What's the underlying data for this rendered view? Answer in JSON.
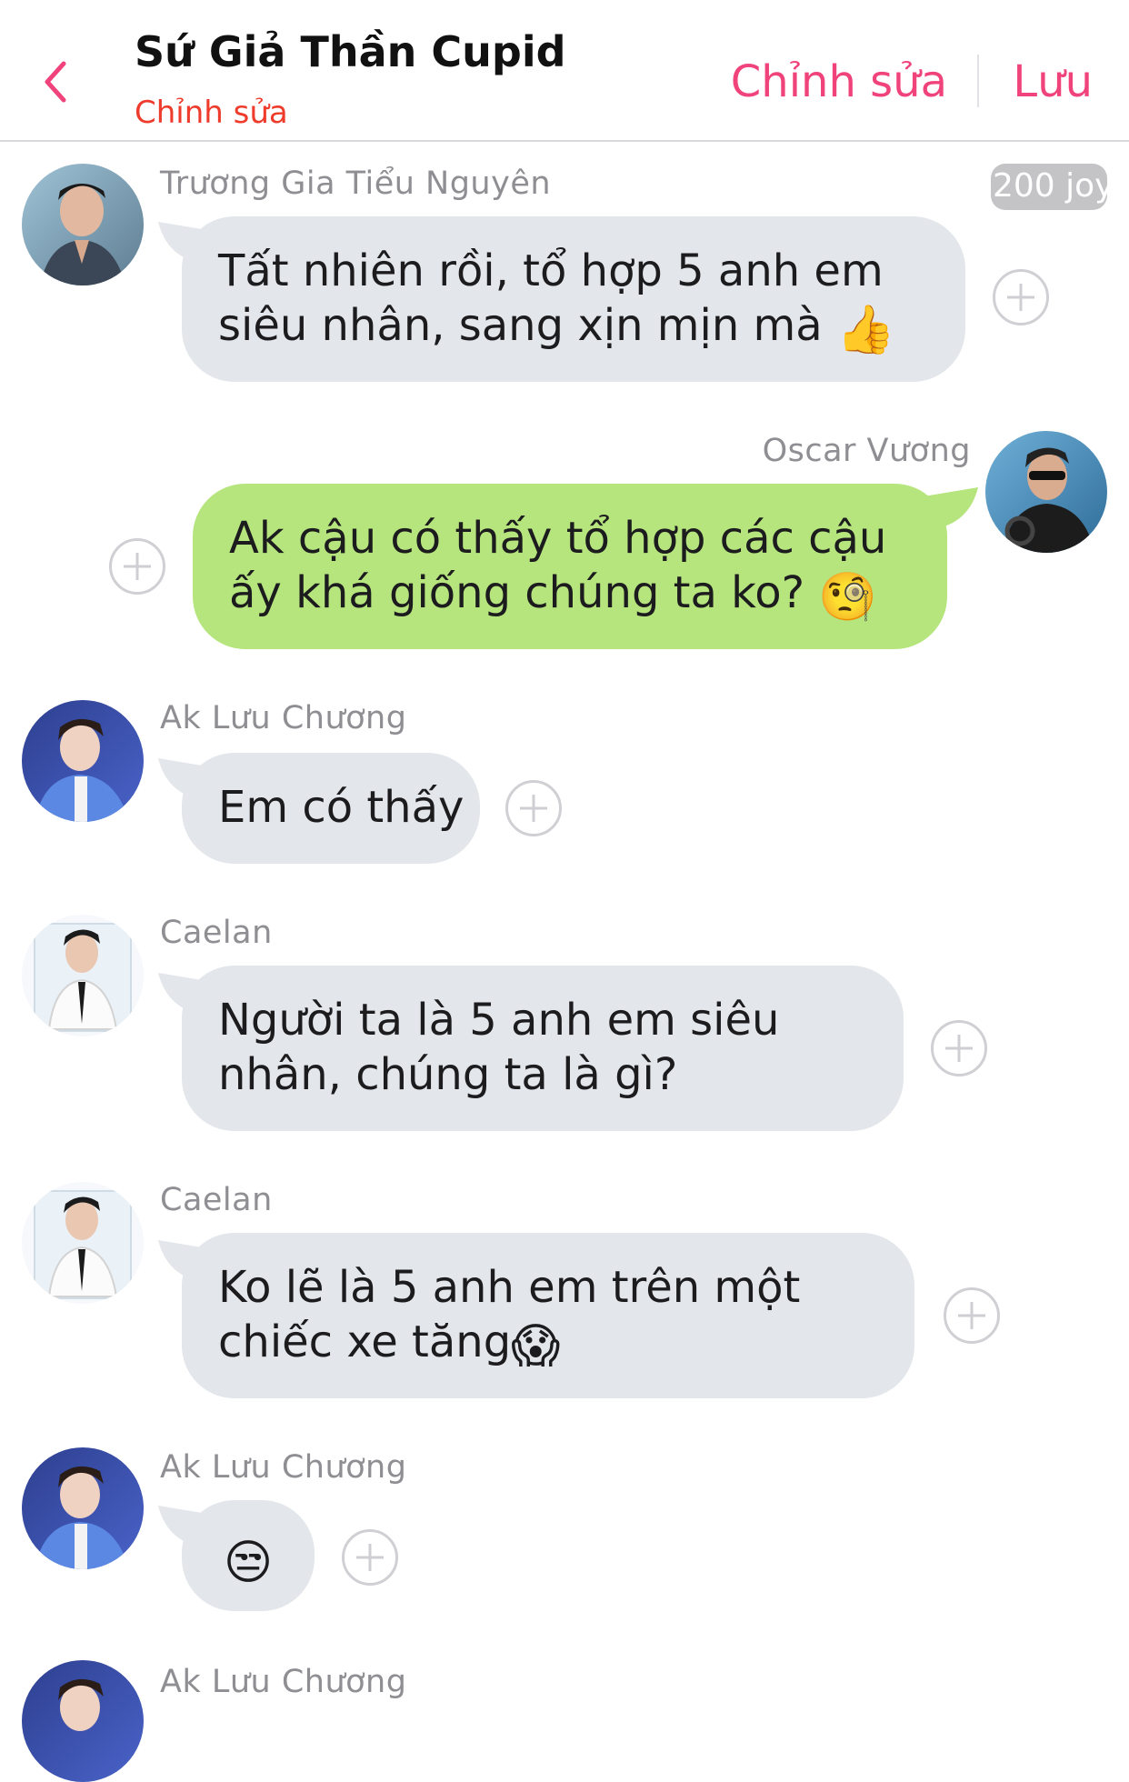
{
  "header": {
    "title": "Sứ Giả Thần Cupid",
    "subtitle": "Chỉnh sửa",
    "edit_label": "Chỉnh sửa",
    "save_label": "Lưu",
    "accent_color": "#f0437b"
  },
  "messages": [
    {
      "sender": "Trương Gia Tiểu Nguyên",
      "text": "Tất nhiên rồi, tổ hợp 5 anh em siêu nhân, sang xịn mịn mà",
      "emoji": "👍",
      "badge": "200 joy",
      "direction": "incoming"
    },
    {
      "sender": "Oscar Vương",
      "text": "Ak cậu có thấy tổ hợp các cậu ấy khá giống chúng ta ko?",
      "emoji": "🧐",
      "direction": "outgoing"
    },
    {
      "sender": "Ak Lưu Chương",
      "text": "Em có thấy",
      "direction": "incoming"
    },
    {
      "sender": "Caelan",
      "text": "Người ta là 5 anh em siêu nhân, chúng ta là gì?",
      "direction": "incoming"
    },
    {
      "sender": "Caelan",
      "text": "Ko lẽ là 5 anh em trên một chiếc xe tăng",
      "emoji": "😱",
      "direction": "incoming"
    },
    {
      "sender": "Ak Lưu Chương",
      "text": "",
      "emoji": "😒",
      "direction": "incoming"
    },
    {
      "sender": "Ak Lưu Chương",
      "text": "",
      "direction": "incoming"
    }
  ],
  "colors": {
    "incoming_bubble": "#e3e6ea",
    "outgoing_bubble": "#b6e57e",
    "subtitle": "#ee3b2c"
  }
}
